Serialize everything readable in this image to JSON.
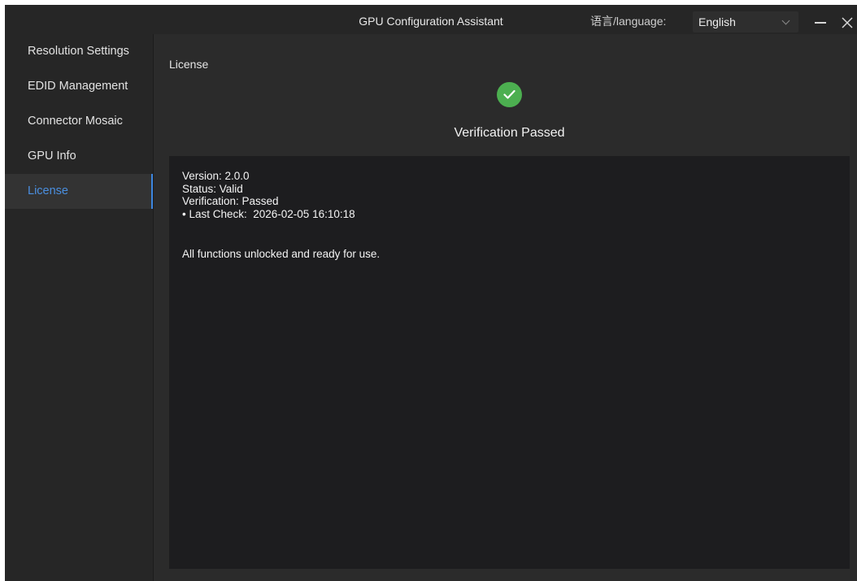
{
  "window": {
    "title": "GPU Configuration Assistant",
    "language_label": "语言/language:",
    "language_value": "English"
  },
  "sidebar": {
    "items": [
      {
        "label": "Resolution Settings",
        "active": false
      },
      {
        "label": "EDID Management",
        "active": false
      },
      {
        "label": "Connector Mosaic",
        "active": false
      },
      {
        "label": "GPU Info",
        "active": false
      },
      {
        "label": "License",
        "active": true
      }
    ]
  },
  "main": {
    "page_title": "License",
    "status_icon": "check-circle-icon",
    "status_title": "Verification Passed",
    "details": {
      "version": "Version: 2.0.0",
      "status": "Status: Valid",
      "verification": "Verification: Passed",
      "last_check": "• Last Check:  2026-02-05 16:10:18",
      "summary": "All functions unlocked and ready for use."
    }
  },
  "colors": {
    "accent": "#3d86e0",
    "success": "#4caf50",
    "background": "#2b2b2b",
    "panel": "#1d1d1f"
  }
}
